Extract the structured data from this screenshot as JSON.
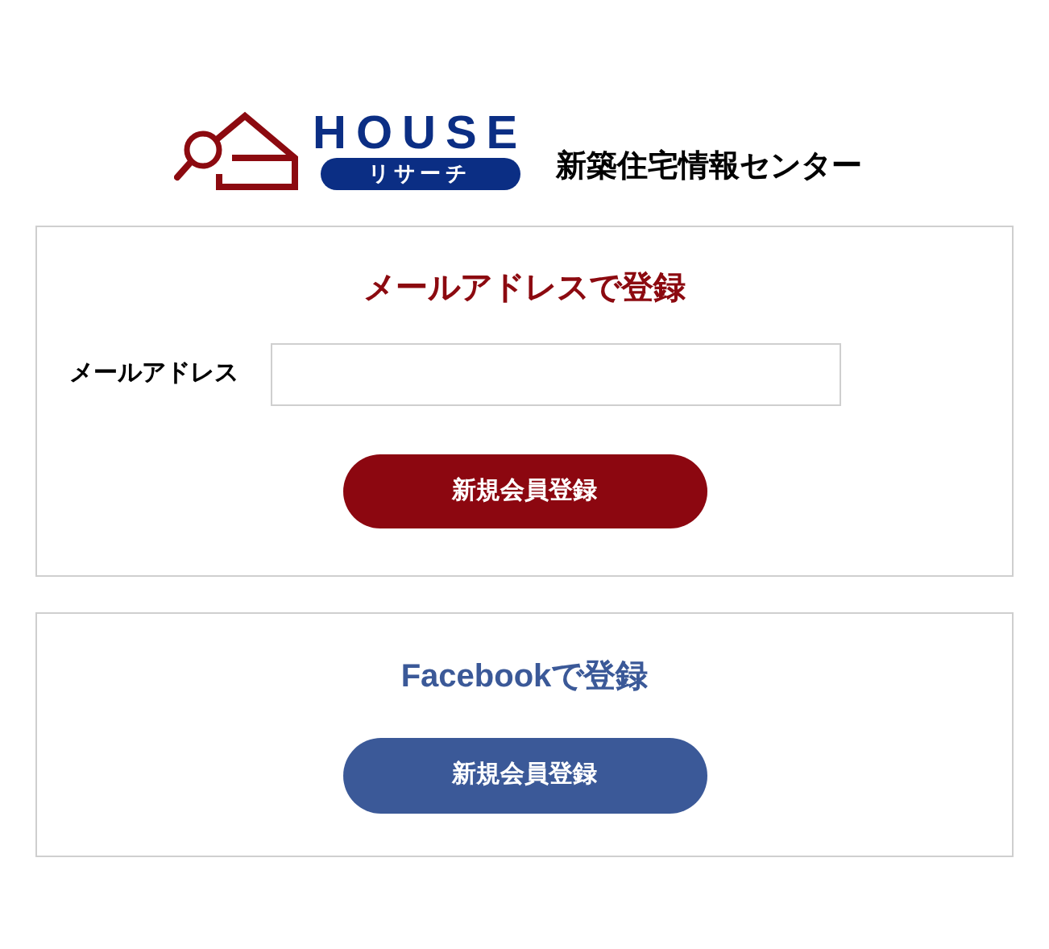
{
  "logo": {
    "word": "HOUSE",
    "badge": "リサーチ"
  },
  "tagline": "新築住宅情報センター",
  "email_card": {
    "title": "メールアドレスで登録",
    "field_label": "メールアドレス",
    "button": "新規会員登録"
  },
  "facebook_card": {
    "title": "Facebookで登録",
    "button": "新規会員登録"
  }
}
